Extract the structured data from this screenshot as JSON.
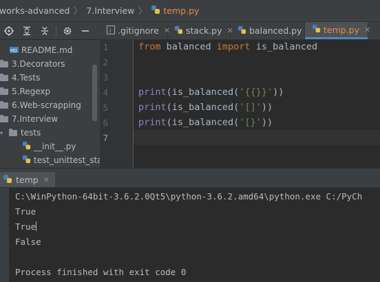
{
  "breadcrumb": {
    "project": "works-advanced",
    "folder": "7.Interview",
    "file": "temp.py"
  },
  "editor_tabs": [
    {
      "label": ".gitignore",
      "active": false
    },
    {
      "label": "stack.py",
      "active": false
    },
    {
      "label": "balanced.py",
      "active": false
    },
    {
      "label": "temp.py",
      "active": true
    }
  ],
  "tree": {
    "items": [
      {
        "label": "README.md",
        "type": "file"
      },
      {
        "label": "3.Decorators",
        "type": "folder"
      },
      {
        "label": "4.Tests",
        "type": "folder"
      },
      {
        "label": "5.Regexp",
        "type": "folder"
      },
      {
        "label": "6.Web-scrapping",
        "type": "folder"
      },
      {
        "label": "7.Interview",
        "type": "folder"
      },
      {
        "label": "tests",
        "type": "folder"
      },
      {
        "label": "__init__.py",
        "type": "py"
      },
      {
        "label": "test_unittest_stack",
        "type": "py"
      }
    ]
  },
  "code": {
    "line_numbers": [
      "1",
      "2",
      "3",
      "4",
      "5",
      "6",
      "7"
    ],
    "line1": {
      "kw1": "from",
      "mod": " balanced ",
      "kw2": "import",
      "name": " is_balanced"
    },
    "line4": {
      "fn": "print",
      "mid": "(is_balanced(",
      "str": "'{{}}'",
      "end": "))"
    },
    "line5": {
      "fn": "print",
      "mid": "(is_balanced(",
      "str": "'[]'",
      "end": "))"
    },
    "line6": {
      "fn": "print",
      "mid": "(is_balanced(",
      "str": "'[}'",
      "end": "))"
    }
  },
  "run": {
    "tab_label": "temp",
    "command": "C:\\WinPython-64bit-3.6.2.0Qt5\\python-3.6.2.amd64\\python.exe C:/PyCh",
    "output": [
      "True",
      "True",
      "False"
    ],
    "exit_message": "Process finished with exit code 0"
  },
  "colors": {
    "keyword": "#cc7832",
    "string": "#6a8759",
    "builtin": "#8888c6",
    "active_file": "#e98a4e",
    "tab_underline": "#4a88c7"
  }
}
